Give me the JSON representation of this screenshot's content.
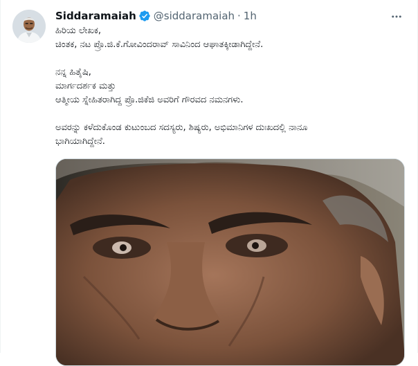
{
  "tweet": {
    "author_name": "Siddaramaiah",
    "handle": "@siddaramaiah",
    "separator": "·",
    "timestamp": "1h",
    "lines": [
      "ಹಿರಿಯ ಲೇಖಕ,",
      "ಚಿಂತಕ, ನಟ ಪ್ರೊ.ಜಿ.ಕೆ.ಗೋವಿಂದರಾವ್ ಸಾವಿನಿಂದ ಆಘಾತಕ್ಕೀಡಾಗಿದ್ದೇನೆ.",
      "",
      "ನನ್ನ ಹಿತೈಷಿ,",
      "ಮಾರ್ಗದರ್ಶಕ ಮತ್ತು",
      "ಆತ್ಮೀಯ ಸ್ನೇಹಿತರಾಗಿದ್ದ ಪ್ರೊ.ಜಿಕೆಜಿ ಅವರಿಗೆ ಗೌರವದ ನಮನಗಳು.",
      "",
      "ಅವರನ್ನು ಕಳೆದುಕೊಂಡ ಕುಟುಂಬದ ಸದಸ್ಯರು, ಶಿಷ್ಯರು, ಅಭಿಮಾನಿಗಳ ದುಃಖದಲ್ಲಿ ನಾನೂ",
      "ಭಾಗಿಯಾಗಿದ್ದೇನೆ."
    ]
  },
  "icons": {
    "verified": "verified-badge-icon",
    "more": "more-options-icon"
  },
  "colors": {
    "verified": "#1d9bf0",
    "secondary_text": "#536471",
    "primary_text": "#0f1419"
  }
}
